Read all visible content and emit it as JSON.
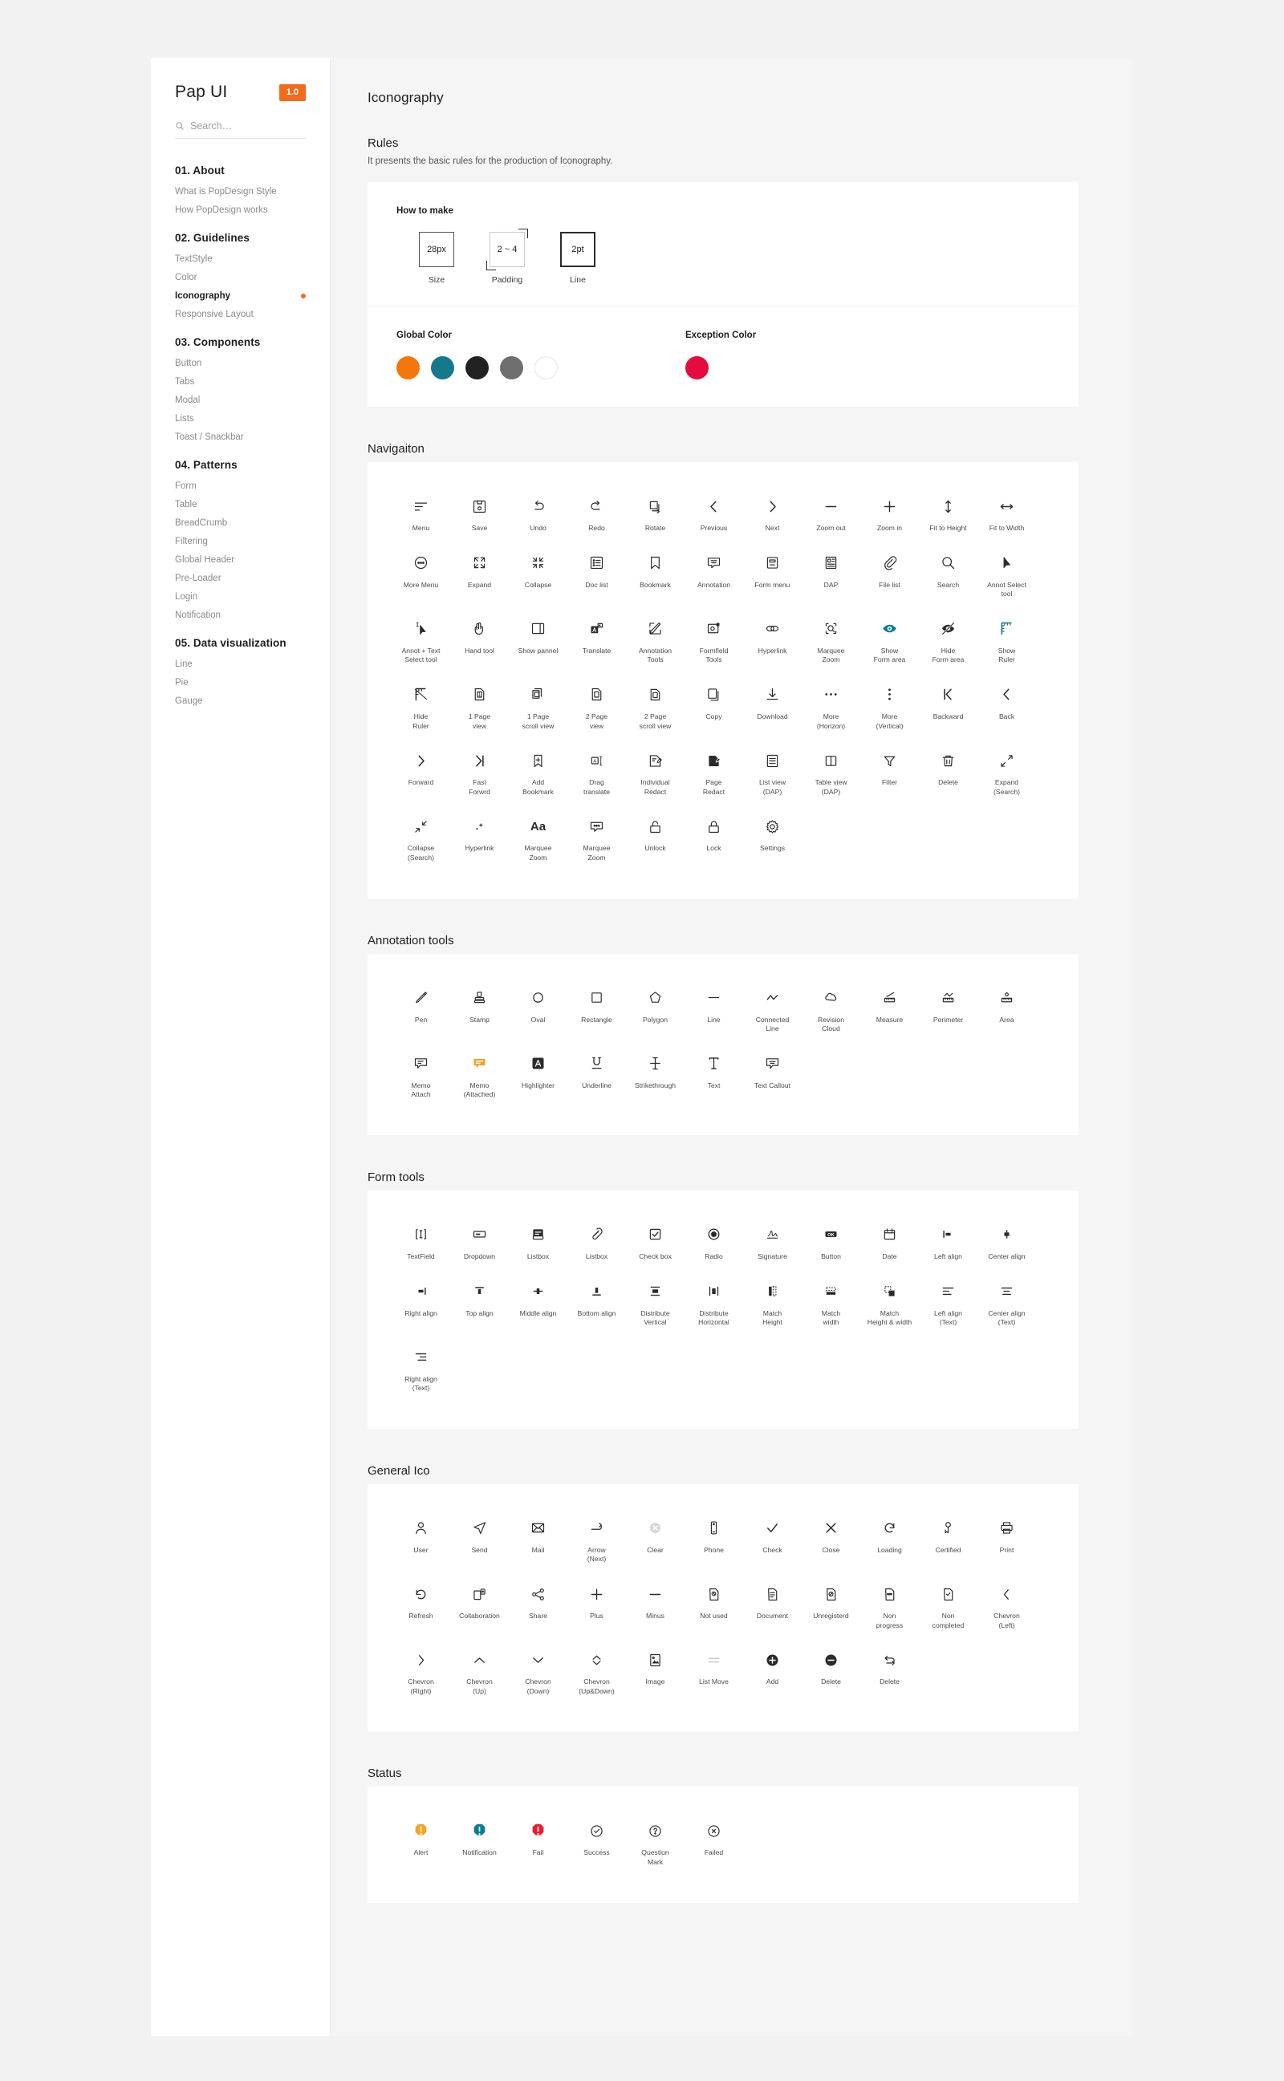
{
  "sidebar": {
    "brand": "Pap UI",
    "version": "1.0",
    "search_placeholder": "Search…",
    "groups": [
      {
        "title": "01. About",
        "items": [
          {
            "label": "What is PopDesign Style",
            "active": false
          },
          {
            "label": "How PopDesign works",
            "active": false
          }
        ]
      },
      {
        "title": "02. Guidelines",
        "items": [
          {
            "label": "TextStyle",
            "active": false
          },
          {
            "label": "Color",
            "active": false
          },
          {
            "label": "Iconography",
            "active": true
          },
          {
            "label": "Responsive Layout",
            "active": false
          }
        ]
      },
      {
        "title": "03. Components",
        "items": [
          {
            "label": "Button",
            "active": false
          },
          {
            "label": "Tabs",
            "active": false
          },
          {
            "label": "Modal",
            "active": false
          },
          {
            "label": "Lists",
            "active": false
          },
          {
            "label": "Toast / Snackbar",
            "active": false
          }
        ]
      },
      {
        "title": "04. Patterns",
        "items": [
          {
            "label": "Form",
            "active": false
          },
          {
            "label": "Table",
            "active": false
          },
          {
            "label": "BreadCrumb",
            "active": false
          },
          {
            "label": "Filtering",
            "active": false
          },
          {
            "label": "Global Header",
            "active": false
          },
          {
            "label": "Pre-Loader",
            "active": false
          },
          {
            "label": "Login",
            "active": false
          },
          {
            "label": "Notification",
            "active": false
          }
        ]
      },
      {
        "title": "05. Data visualization",
        "items": [
          {
            "label": "Line",
            "active": false
          },
          {
            "label": "Pie",
            "active": false
          },
          {
            "label": "Gauge",
            "active": false
          }
        ]
      }
    ]
  },
  "page": {
    "title": "Iconography"
  },
  "rules": {
    "title": "Rules",
    "desc": "It presents the basic rules for the production of Iconography.",
    "howto_label": "How to make",
    "specs": [
      {
        "value": "28px",
        "caption": "Size",
        "kind": "size"
      },
      {
        "value": "2 ~ 4",
        "caption": "Padding",
        "kind": "pad"
      },
      {
        "value": "2pt",
        "caption": "Line",
        "kind": "line"
      }
    ],
    "global_color_label": "Global Color",
    "global_colors": [
      "#f4770b",
      "#16788d",
      "#222222",
      "#6e6e6e",
      "#ffffff"
    ],
    "exception_color_label": "Exception Color",
    "exception_colors": [
      "#e30b3f"
    ]
  },
  "sections": [
    {
      "title": "Navigaiton",
      "icons": [
        {
          "name": "menu",
          "label": "Menu"
        },
        {
          "name": "save",
          "label": "Save"
        },
        {
          "name": "undo",
          "label": "Undo"
        },
        {
          "name": "redo",
          "label": "Redo"
        },
        {
          "name": "rotate",
          "label": "Rotate"
        },
        {
          "name": "previous",
          "label": "Previous"
        },
        {
          "name": "next",
          "label": "Next"
        },
        {
          "name": "zoom-out",
          "label": "Zoom out"
        },
        {
          "name": "zoom-in",
          "label": "Zoom in"
        },
        {
          "name": "fit-to-height",
          "label": "Fit to Height"
        },
        {
          "name": "fit-to-width",
          "label": "Fit to Width"
        },
        {
          "name": "more-menu",
          "label": "More Menu"
        },
        {
          "name": "expand",
          "label": "Expand"
        },
        {
          "name": "collapse",
          "label": "Collapse"
        },
        {
          "name": "doc-list",
          "label": "Doc list"
        },
        {
          "name": "bookmark",
          "label": "Bookmark"
        },
        {
          "name": "annotation",
          "label": "Annotation"
        },
        {
          "name": "form-menu",
          "label": "Form menu"
        },
        {
          "name": "dap",
          "label": "DAP"
        },
        {
          "name": "file-list",
          "label": "File list"
        },
        {
          "name": "search",
          "label": "Search"
        },
        {
          "name": "annot-select-tool",
          "label": "Annot Select\ntool"
        },
        {
          "name": "annot-text-select-tool",
          "label": "Annot + Text\nSelect tool"
        },
        {
          "name": "hand-tool",
          "label": "Hand tool"
        },
        {
          "name": "show-pannel",
          "label": "Show pannel"
        },
        {
          "name": "translate",
          "label": "Translate"
        },
        {
          "name": "annotation-tools",
          "label": "Annotation\nTools"
        },
        {
          "name": "formfield-tools",
          "label": "Formfield\nTools"
        },
        {
          "name": "hyperlink",
          "label": "Hyperlink"
        },
        {
          "name": "marquee-zoom",
          "label": "Marquee\nZoom"
        },
        {
          "name": "show-form-area",
          "label": "Show\nForm area",
          "color": "teal"
        },
        {
          "name": "hide-form-area",
          "label": "Hide\nForm area"
        },
        {
          "name": "show-ruler",
          "label": "Show\nRuler",
          "color": "teal"
        },
        {
          "name": "hide-ruler",
          "label": "Hide\nRuler"
        },
        {
          "name": "one-page-view",
          "label": "1 Page\nview"
        },
        {
          "name": "one-page-scroll-view",
          "label": "1 Page\nscroll view"
        },
        {
          "name": "two-page-view",
          "label": "2 Page\nview"
        },
        {
          "name": "two-page-scroll-view",
          "label": "2 Page\nscroll view"
        },
        {
          "name": "copy",
          "label": "Copy"
        },
        {
          "name": "download",
          "label": "Download"
        },
        {
          "name": "more-horizon",
          "label": "More\n(Horizon)"
        },
        {
          "name": "more-vertical",
          "label": "More\n(Vertical)"
        },
        {
          "name": "backward",
          "label": "Backward"
        },
        {
          "name": "back",
          "label": "Back"
        },
        {
          "name": "forward",
          "label": "Forward"
        },
        {
          "name": "fast-forward",
          "label": "Fast\nForwrd"
        },
        {
          "name": "add-bookmark",
          "label": "Add\nBookmark"
        },
        {
          "name": "drag-translate",
          "label": "Drag\ntranslate"
        },
        {
          "name": "individual-redact",
          "label": "Individual\nRedact"
        },
        {
          "name": "page-redact",
          "label": "Page\nRedact"
        },
        {
          "name": "list-view-dap",
          "label": "List view\n(DAP)"
        },
        {
          "name": "table-view-dap",
          "label": "Table view\n(DAP)"
        },
        {
          "name": "filter",
          "label": "Filter"
        },
        {
          "name": "delete-trash",
          "label": "Delete"
        },
        {
          "name": "expand-search",
          "label": "Expand\n(Search)"
        },
        {
          "name": "collapse-search",
          "label": "Collapse\n(Search)"
        },
        {
          "name": "hyperlink-star",
          "label": "Hyperlink"
        },
        {
          "name": "marquee-zoom-aa",
          "label": "Marquee\nZoom"
        },
        {
          "name": "marquee-zoom-balloon",
          "label": "Marquee\nZoom"
        },
        {
          "name": "unlock",
          "label": "Unlock"
        },
        {
          "name": "lock",
          "label": "Lock"
        },
        {
          "name": "settings",
          "label": "Settings"
        }
      ]
    },
    {
      "title": "Annotation tools",
      "icons": [
        {
          "name": "pen",
          "label": "Pen"
        },
        {
          "name": "stamp",
          "label": "Stamp"
        },
        {
          "name": "oval",
          "label": "Oval"
        },
        {
          "name": "rectangle",
          "label": "Rectangle"
        },
        {
          "name": "polygon",
          "label": "Polygon"
        },
        {
          "name": "line",
          "label": "Line"
        },
        {
          "name": "connected-line",
          "label": "Connected\nLine"
        },
        {
          "name": "revision-cloud",
          "label": "Revision\nCloud"
        },
        {
          "name": "measure",
          "label": "Measure"
        },
        {
          "name": "perimeter",
          "label": "Perimeter"
        },
        {
          "name": "area",
          "label": "Area"
        },
        {
          "name": "memo-attach",
          "label": "Memo\nAttach"
        },
        {
          "name": "memo-attached",
          "label": "Memo\n(Attached)",
          "color": "amber"
        },
        {
          "name": "highlighter",
          "label": "Highlighter"
        },
        {
          "name": "underline",
          "label": "Underline"
        },
        {
          "name": "strikethrough",
          "label": "Strikethrough"
        },
        {
          "name": "text",
          "label": "Text"
        },
        {
          "name": "text-callout",
          "label": "Text Callout"
        }
      ]
    },
    {
      "title": "Form tools",
      "icons": [
        {
          "name": "textfield",
          "label": "TextField"
        },
        {
          "name": "dropdown",
          "label": "Dropdown"
        },
        {
          "name": "listbox",
          "label": "Listbox"
        },
        {
          "name": "listbox-link",
          "label": "Listbox"
        },
        {
          "name": "check-box",
          "label": "Check box"
        },
        {
          "name": "radio",
          "label": "Radio"
        },
        {
          "name": "signature",
          "label": "Signature"
        },
        {
          "name": "button-ok",
          "label": "Button"
        },
        {
          "name": "date",
          "label": "Date"
        },
        {
          "name": "left-align",
          "label": "Left align"
        },
        {
          "name": "center-align",
          "label": "Center align"
        },
        {
          "name": "right-align",
          "label": "Right align"
        },
        {
          "name": "top-align",
          "label": "Top align"
        },
        {
          "name": "middle-align",
          "label": "Middle align"
        },
        {
          "name": "bottom-align",
          "label": "Bottom align"
        },
        {
          "name": "distribute-vertical",
          "label": "Distribute\nVertical"
        },
        {
          "name": "distribute-horizontal",
          "label": "Distribute\nHorizontal"
        },
        {
          "name": "match-height",
          "label": "Match\nHeight"
        },
        {
          "name": "match-width",
          "label": "Match\nwidth"
        },
        {
          "name": "match-height-width",
          "label": "Match\nHeight & width"
        },
        {
          "name": "left-align-text",
          "label": "Left align\n(Text)"
        },
        {
          "name": "center-align-text",
          "label": "Center align\n(Text)"
        },
        {
          "name": "right-align-text",
          "label": "Right align\n(Text)"
        }
      ]
    },
    {
      "title": "General Ico",
      "icons": [
        {
          "name": "user",
          "label": "User"
        },
        {
          "name": "send",
          "label": "Send"
        },
        {
          "name": "mail",
          "label": "Mail"
        },
        {
          "name": "arrow-next",
          "label": "Arrow\n(Next)"
        },
        {
          "name": "clear",
          "label": "Clear",
          "color": "grey"
        },
        {
          "name": "phone",
          "label": "Phone"
        },
        {
          "name": "check",
          "label": "Check"
        },
        {
          "name": "close",
          "label": "Close"
        },
        {
          "name": "loading",
          "label": "Loading"
        },
        {
          "name": "certified",
          "label": "Certified"
        },
        {
          "name": "print",
          "label": "Print"
        },
        {
          "name": "refresh",
          "label": "Refresh"
        },
        {
          "name": "collaboration",
          "label": "Collaboration"
        },
        {
          "name": "share",
          "label": "Share"
        },
        {
          "name": "plus",
          "label": "Plus"
        },
        {
          "name": "minus",
          "label": "Minus"
        },
        {
          "name": "not-used",
          "label": "Not used"
        },
        {
          "name": "document",
          "label": "Document"
        },
        {
          "name": "unregisterd",
          "label": "Unregisterd"
        },
        {
          "name": "non-progress",
          "label": "Non\nprogress"
        },
        {
          "name": "non-completed",
          "label": "Non\ncompleted"
        },
        {
          "name": "chevron-left",
          "label": "Chevron\n(Left)"
        },
        {
          "name": "chevron-right",
          "label": "Chevron\n(Right)"
        },
        {
          "name": "chevron-up",
          "label": "Chevron\n(Up)"
        },
        {
          "name": "chevron-down",
          "label": "Chevron\n(Down)"
        },
        {
          "name": "chevron-up-down",
          "label": "Chevron\n(Up&Down)"
        },
        {
          "name": "image",
          "label": "Image"
        },
        {
          "name": "list-move",
          "label": "List Move",
          "color": "grey"
        },
        {
          "name": "add",
          "label": "Add"
        },
        {
          "name": "delete-circle",
          "label": "Delete"
        },
        {
          "name": "delete-arrow",
          "label": "Delete"
        }
      ]
    },
    {
      "title": "Status",
      "icons": [
        {
          "name": "alert",
          "label": "Alert",
          "color": "amber"
        },
        {
          "name": "notification",
          "label": "Notification",
          "color": "teal"
        },
        {
          "name": "fail",
          "label": "Fail",
          "color": "red"
        },
        {
          "name": "success",
          "label": "Success"
        },
        {
          "name": "question-mark",
          "label": "Question\nMark"
        },
        {
          "name": "failed",
          "label": "Failed"
        }
      ]
    }
  ]
}
